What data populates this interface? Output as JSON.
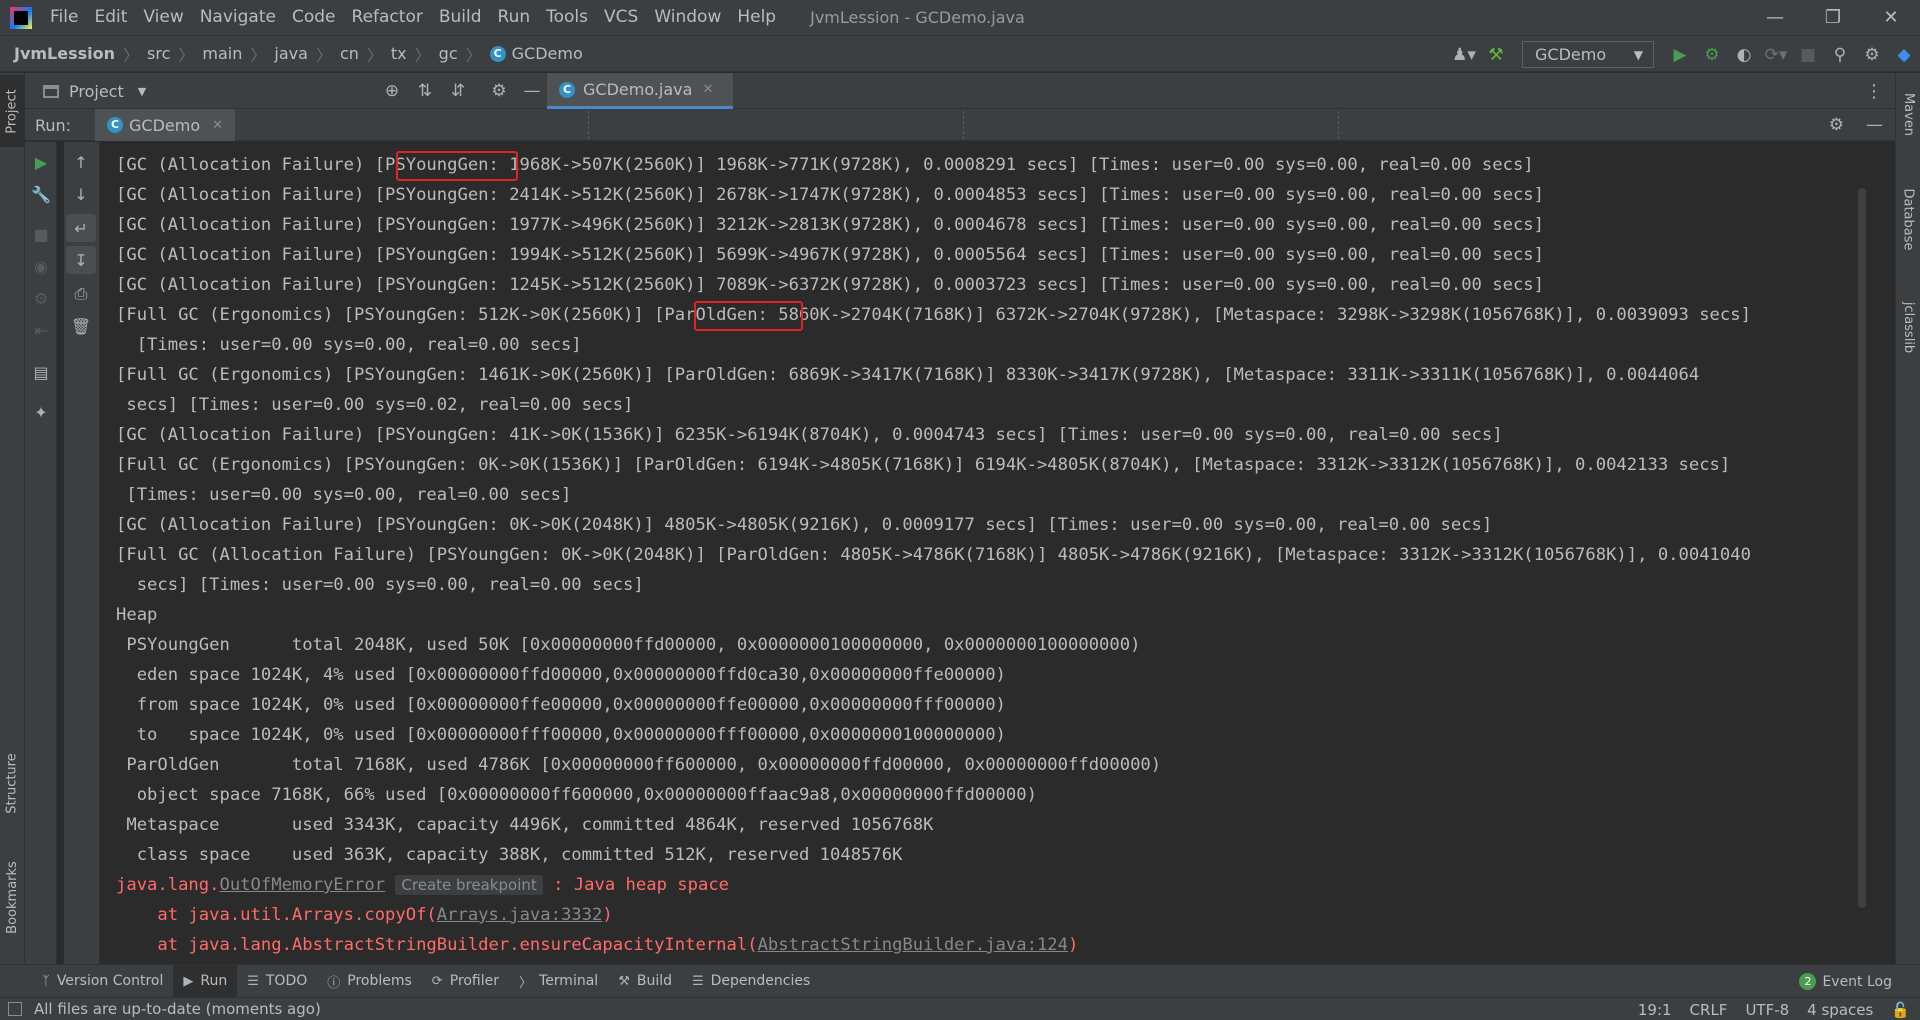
{
  "app": {
    "menu": [
      "File",
      "Edit",
      "View",
      "Navigate",
      "Code",
      "Refactor",
      "Build",
      "Run",
      "Tools",
      "VCS",
      "Window",
      "Help"
    ],
    "window_title": "JvmLession - GCDemo.java"
  },
  "breadcrumb": [
    "JvmLession",
    "src",
    "main",
    "java",
    "cn",
    "tx",
    "gc",
    "GCDemo"
  ],
  "toolbar": {
    "run_config": "GCDemo"
  },
  "left_tabs": [
    "Project",
    "Structure",
    "Bookmarks"
  ],
  "right_tabs": [
    "Maven",
    "Database",
    "jclasslib"
  ],
  "project_panel": {
    "label": "Project"
  },
  "editor_tab": {
    "label": "GCDemo.java"
  },
  "run_panel": {
    "title": "Run:",
    "tab_label": "GCDemo"
  },
  "console": {
    "lines": [
      "[GC (Allocation Failure) [PSYoungGen: 1968K->507K(2560K)] 1968K->771K(9728K), 0.0008291 secs] [Times: user=0.00 sys=0.00, real=0.00 secs]",
      "[GC (Allocation Failure) [PSYoungGen: 2414K->512K(2560K)] 2678K->1747K(9728K), 0.0004853 secs] [Times: user=0.00 sys=0.00, real=0.00 secs]",
      "[GC (Allocation Failure) [PSYoungGen: 1977K->496K(2560K)] 3212K->2813K(9728K), 0.0004678 secs] [Times: user=0.00 sys=0.00, real=0.00 secs]",
      "[GC (Allocation Failure) [PSYoungGen: 1994K->512K(2560K)] 5699K->4967K(9728K), 0.0005564 secs] [Times: user=0.00 sys=0.00, real=0.00 secs]",
      "[GC (Allocation Failure) [PSYoungGen: 1245K->512K(2560K)] 7089K->6372K(9728K), 0.0003723 secs] [Times: user=0.00 sys=0.00, real=0.00 secs]",
      "[Full GC (Ergonomics) [PSYoungGen: 512K->0K(2560K)] [ParOldGen: 5860K->2704K(7168K)] 6372K->2704K(9728K), [Metaspace: 3298K->3298K(1056768K)], 0.0039093 secs]",
      "  [Times: user=0.00 sys=0.00, real=0.00 secs]",
      "[Full GC (Ergonomics) [PSYoungGen: 1461K->0K(2560K)] [ParOldGen: 6869K->3417K(7168K)] 8330K->3417K(9728K), [Metaspace: 3311K->3311K(1056768K)], 0.0044064",
      " secs] [Times: user=0.00 sys=0.02, real=0.00 secs]",
      "[GC (Allocation Failure) [PSYoungGen: 41K->0K(1536K)] 6235K->6194K(8704K), 0.0004743 secs] [Times: user=0.00 sys=0.00, real=0.00 secs]",
      "[Full GC (Ergonomics) [PSYoungGen: 0K->0K(1536K)] [ParOldGen: 6194K->4805K(7168K)] 6194K->4805K(8704K), [Metaspace: 3312K->3312K(1056768K)], 0.0042133 secs]",
      " [Times: user=0.00 sys=0.00, real=0.00 secs]",
      "[GC (Allocation Failure) [PSYoungGen: 0K->0K(2048K)] 4805K->4805K(9216K), 0.0009177 secs] [Times: user=0.00 sys=0.00, real=0.00 secs]",
      "[Full GC (Allocation Failure) [PSYoungGen: 0K->0K(2048K)] [ParOldGen: 4805K->4786K(7168K)] 4805K->4786K(9216K), [Metaspace: 3312K->3312K(1056768K)], 0.0041040",
      "  secs] [Times: user=0.00 sys=0.00, real=0.00 secs]",
      "Heap",
      " PSYoungGen      total 2048K, used 50K [0x00000000ffd00000, 0x0000000100000000, 0x0000000100000000)",
      "  eden space 1024K, 4% used [0x00000000ffd00000,0x00000000ffd0ca30,0x00000000ffe00000)",
      "  from space 1024K, 0% used [0x00000000ffe00000,0x00000000ffe00000,0x00000000fff00000)",
      "  to   space 1024K, 0% used [0x00000000fff00000,0x00000000fff00000,0x0000000100000000)",
      " ParOldGen       total 7168K, used 4786K [0x00000000ff600000, 0x00000000ffd00000, 0x00000000ffd00000)",
      "  object space 7168K, 66% used [0x00000000ff600000,0x00000000ffaac9a8,0x00000000ffd00000)",
      " Metaspace       used 3343K, capacity 4496K, committed 4864K, reserved 1056768K",
      "  class space    used 363K, capacity 388K, committed 512K, reserved 1048576K"
    ],
    "error": {
      "prefix": "java.lang.",
      "exception": "OutOfMemoryError",
      "hint": "Create breakpoint",
      "message": " : Java heap space"
    },
    "stack": [
      {
        "prefix": "    at java.util.Arrays.copyOf(",
        "link": "Arrays.java:3332",
        "suffix": ")"
      },
      {
        "prefix": "    at java.lang.AbstractStringBuilder.ensureCapacityInternal(",
        "link": "AbstractStringBuilder.java:124",
        "suffix": ")"
      }
    ]
  },
  "bottom_tools": [
    "Version Control",
    "Run",
    "TODO",
    "Problems",
    "Profiler",
    "Terminal",
    "Build",
    "Dependencies"
  ],
  "event_log": {
    "count": "2",
    "label": "Event Log"
  },
  "status": {
    "message": "All files are up-to-date (moments ago)",
    "position": "19:1",
    "line_sep": "CRLF",
    "encoding": "UTF-8",
    "indent": "4 spaces"
  },
  "colors": {
    "background": "#2b2b2b",
    "panel": "#3c3f41",
    "text": "#bbbbbb",
    "error": "#ff6b68",
    "highlight_box": "#e02424",
    "accent": "#4a88c7"
  },
  "icons": {
    "run": "play-icon",
    "debug": "bug-icon",
    "build": "hammer-icon",
    "search": "search-icon",
    "settings": "gear-icon"
  }
}
